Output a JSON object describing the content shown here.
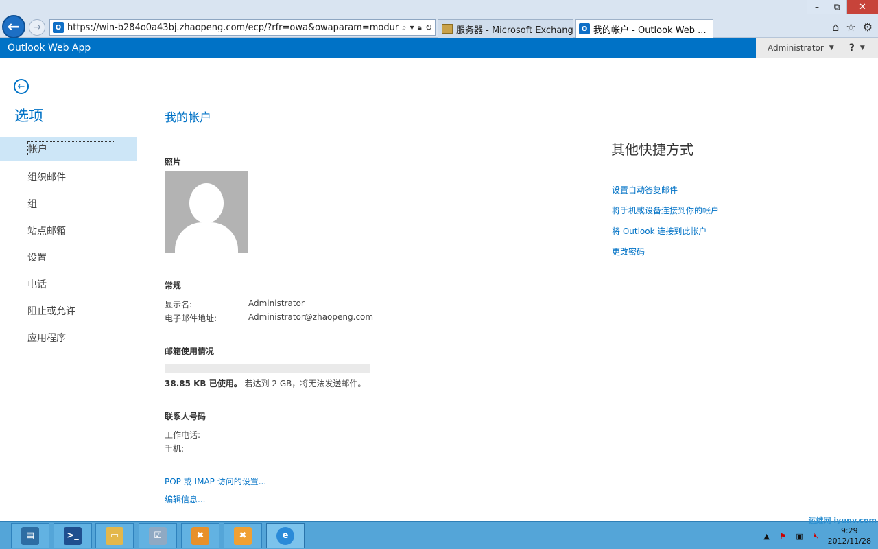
{
  "browser": {
    "url": "https://win-b284o0a43bj.zhaopeng.com/ecp/?rfr=owa&owaparam=modurl%3D(",
    "tabs": [
      {
        "label": "服务器 - Microsoft Exchange"
      },
      {
        "label": "我的帐户 - Outlook Web ..."
      }
    ],
    "favicon_text": "O"
  },
  "owa": {
    "app_title": "Outlook Web App",
    "user": "Administrator",
    "help": "?"
  },
  "nav": {
    "title": "选项",
    "items": [
      {
        "label": "帐户"
      },
      {
        "label": "组织邮件"
      },
      {
        "label": "组"
      },
      {
        "label": "站点邮箱"
      },
      {
        "label": "设置"
      },
      {
        "label": "电话"
      },
      {
        "label": "阻止或允许"
      },
      {
        "label": "应用程序"
      }
    ]
  },
  "main": {
    "title": "我的帐户",
    "photo_label": "照片",
    "general_label": "常规",
    "display_name_label": "显示名:",
    "display_name_value": "Administrator",
    "email_label": "电子邮件地址:",
    "email_value": "Administrator@zhaopeng.com",
    "mailbox_usage_label": "邮箱使用情况",
    "usage_used": "38.85 KB 已使用。",
    "usage_note": "若达到 2 GB，将无法发送邮件。",
    "usage_fraction": 0.0,
    "contact_label": "联系人号码",
    "work_phone_label": "工作电话:",
    "mobile_label": "手机:",
    "pop_imap_link": "POP 或 IMAP 访问的设置...",
    "edit_link": "编辑信息..."
  },
  "shortcuts": {
    "title": "其他快捷方式",
    "links": [
      {
        "label": "设置自动答复邮件"
      },
      {
        "label": "将手机或设备连接到你的帐户"
      },
      {
        "label": "将 Outlook 连接到此帐户"
      },
      {
        "label": "更改密码"
      }
    ]
  },
  "taskbar": {
    "time": "9:29",
    "date": "2012/11/28"
  },
  "watermark": "运维网 iyunv.com",
  "colors": {
    "accent": "#0072c6",
    "taskbar": "#54a5d8"
  }
}
